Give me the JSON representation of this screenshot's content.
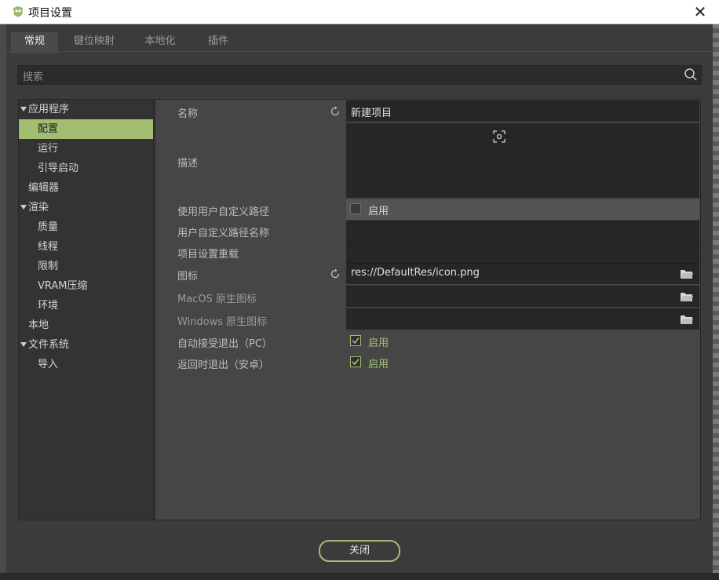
{
  "window": {
    "title": "项目设置",
    "close_symbol": "✕"
  },
  "tabs": [
    {
      "label": "常规",
      "active": true
    },
    {
      "label": "键位映射",
      "active": false
    },
    {
      "label": "本地化",
      "active": false
    },
    {
      "label": "插件",
      "active": false
    }
  ],
  "search": {
    "placeholder": "搜索",
    "icon": "search-icon"
  },
  "tree": [
    {
      "label": "应用程序",
      "level": 0,
      "expanded": true
    },
    {
      "label": "配置",
      "level": 1,
      "selected": true
    },
    {
      "label": "运行",
      "level": 1
    },
    {
      "label": "引导启动",
      "level": 1
    },
    {
      "label": "编辑器",
      "level": 0
    },
    {
      "label": "渲染",
      "level": 0,
      "expanded": true
    },
    {
      "label": "质量",
      "level": 1
    },
    {
      "label": "线程",
      "level": 1
    },
    {
      "label": "限制",
      "level": 1
    },
    {
      "label": "VRAM压缩",
      "level": 1
    },
    {
      "label": "环境",
      "level": 1
    },
    {
      "label": "本地",
      "level": 0
    },
    {
      "label": "文件系统",
      "level": 0,
      "expanded": true
    },
    {
      "label": "导入",
      "level": 1
    }
  ],
  "properties": {
    "name": {
      "label": "名称",
      "value": "新建项目"
    },
    "description": {
      "label": "描述",
      "value": ""
    },
    "use_custom_path": {
      "label": "使用用户自定义路径",
      "check_label": "启用",
      "checked": false
    },
    "custom_path_name": {
      "label": "用户自定义路径名称",
      "value": ""
    },
    "settings_override": {
      "label": "项目设置重载",
      "value": ""
    },
    "icon": {
      "label": "图标",
      "value": "res://DefaultRes/icon.png"
    },
    "macos_icon": {
      "label": "MacOS 原生图标",
      "value": ""
    },
    "windows_icon": {
      "label": "Windows 原生图标",
      "value": ""
    },
    "auto_accept_quit": {
      "label": "自动接受退出（PC）",
      "check_label": "启用",
      "checked": true
    },
    "quit_on_back": {
      "label": "返回时退出（安卓）",
      "check_label": "启用",
      "checked": true
    }
  },
  "footer": {
    "close_label": "关闭"
  },
  "colors": {
    "accent": "#a3bd73",
    "panel": "#464646",
    "field": "#262626"
  }
}
